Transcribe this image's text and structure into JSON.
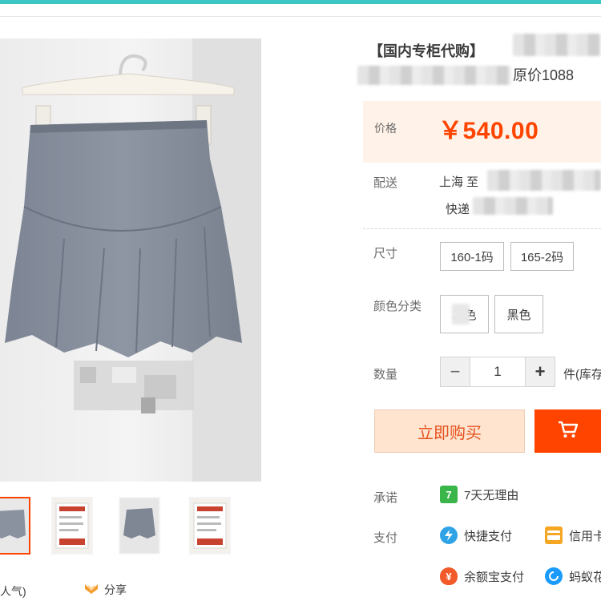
{
  "product": {
    "title": "【国内专柜代购】",
    "subtitle_suffix": "原价1088",
    "price_label": "价格",
    "price": "￥540.00"
  },
  "delivery": {
    "label": "配送",
    "from": "上海 至",
    "method": "快递"
  },
  "size": {
    "label": "尺寸",
    "options": [
      "160-1码",
      "165-2码"
    ]
  },
  "color": {
    "label": "颜色分类",
    "options": [
      "灰色",
      "黑色"
    ]
  },
  "quantity": {
    "label": "数量",
    "minus": "−",
    "value": "1",
    "plus": "+",
    "stock_text": "件(库存"
  },
  "actions": {
    "buy_now": "立即购买",
    "cart_icon": "shopping-cart-icon"
  },
  "promise": {
    "label": "承诺",
    "text": "7天无理由",
    "badge": "7"
  },
  "payment": {
    "label": "支付",
    "methods": [
      "快捷支付",
      "信用卡",
      "余额宝支付",
      "蚂蚁花"
    ]
  },
  "gallery": {
    "popularity": "人气)",
    "share": "分享"
  },
  "colors": {
    "accent": "#ff4400",
    "price_bg": "#fff2e8",
    "topbar": "#3cc7c4"
  }
}
